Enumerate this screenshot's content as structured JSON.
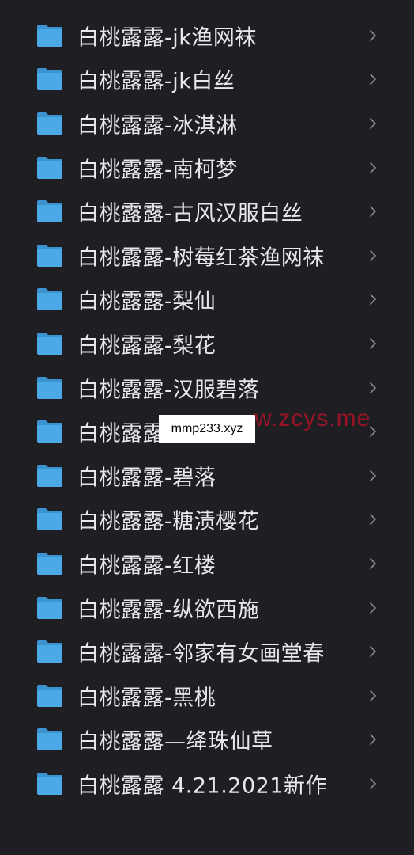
{
  "colors": {
    "background": "#1e1e23",
    "folder": "#4aa9e6",
    "text": "#e8e8ea",
    "chevron": "#8a8a90"
  },
  "items": [
    {
      "label": "白桃露露-jk渔网袜",
      "icon": "folder-icon"
    },
    {
      "label": "白桃露露-jk白丝",
      "icon": "folder-icon"
    },
    {
      "label": "白桃露露-冰淇淋",
      "icon": "folder-icon"
    },
    {
      "label": "白桃露露-南柯梦",
      "icon": "folder-icon"
    },
    {
      "label": "白桃露露-古风汉服白丝",
      "icon": "folder-icon"
    },
    {
      "label": "白桃露露-树莓红茶渔网袜",
      "icon": "folder-icon"
    },
    {
      "label": "白桃露露-梨仙",
      "icon": "folder-icon"
    },
    {
      "label": "白桃露露-梨花",
      "icon": "folder-icon"
    },
    {
      "label": "白桃露露-汉服碧落",
      "icon": "folder-icon"
    },
    {
      "label": "白桃露露",
      "icon": "folder-icon"
    },
    {
      "label": "白桃露露-碧落",
      "icon": "folder-icon"
    },
    {
      "label": "白桃露露-糖渍樱花",
      "icon": "folder-icon"
    },
    {
      "label": "白桃露露-红楼",
      "icon": "folder-icon"
    },
    {
      "label": "白桃露露-纵欲西施",
      "icon": "folder-icon"
    },
    {
      "label": "白桃露露-邻家有女画堂春",
      "icon": "folder-icon"
    },
    {
      "label": "白桃露露-黑桃",
      "icon": "folder-icon"
    },
    {
      "label": "白桃露露—绛珠仙草",
      "icon": "folder-icon"
    },
    {
      "label": "白桃露露 4.21.2021新作",
      "icon": "folder-icon"
    }
  ],
  "watermark": {
    "box_text": "mmp233.xyz",
    "red_text": "w.zcys.me"
  }
}
